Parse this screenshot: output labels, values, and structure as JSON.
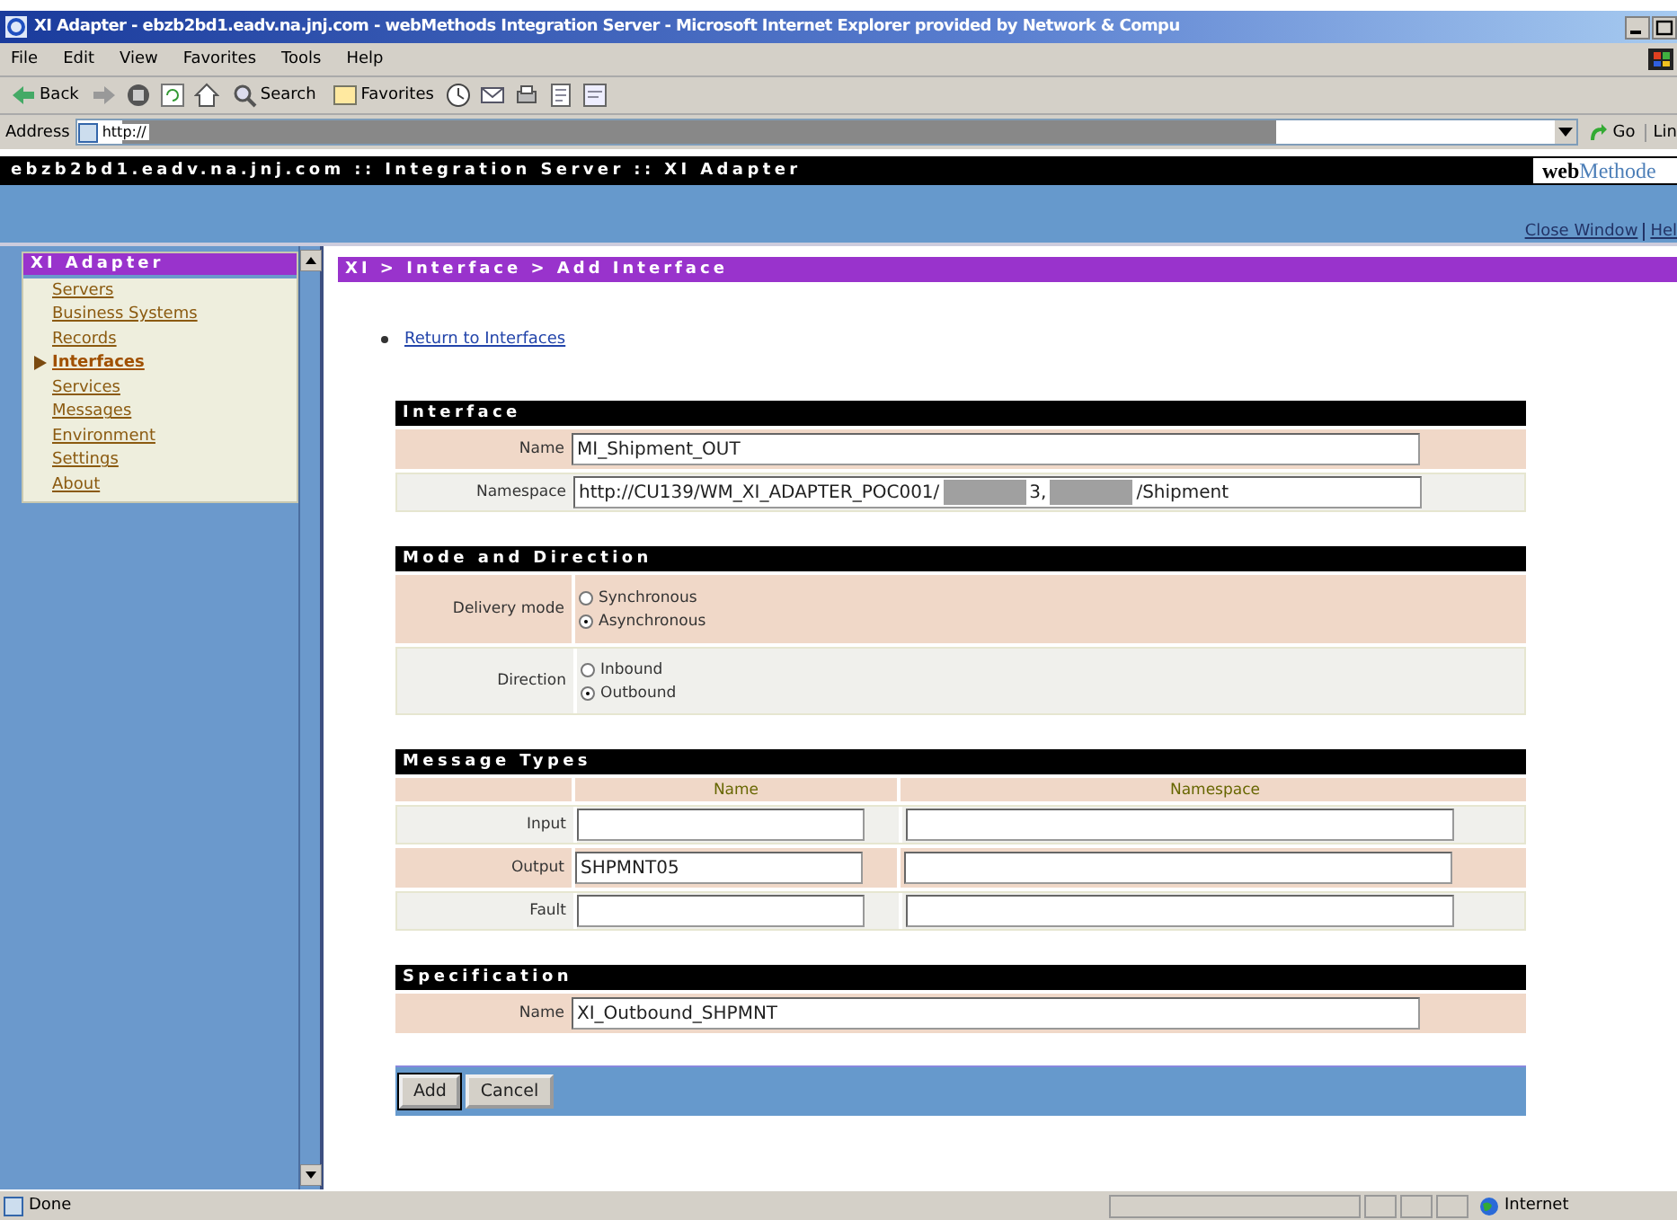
{
  "window": {
    "title": "XI Adapter - ebzb2bd1.eadv.na.jnj.com - webMethods Integration Server - Microsoft Internet Explorer provided by Network & Compu"
  },
  "menu": [
    "File",
    "Edit",
    "View",
    "Favorites",
    "Tools",
    "Help"
  ],
  "toolbar": [
    {
      "kind": "back",
      "label": "Back"
    },
    {
      "kind": "forward"
    },
    {
      "kind": "stop"
    },
    {
      "kind": "refresh"
    },
    {
      "kind": "home"
    },
    {
      "kind": "search",
      "label": "Search"
    },
    {
      "kind": "favorites",
      "label": "Favorites"
    },
    {
      "kind": "history"
    },
    {
      "kind": "mail"
    },
    {
      "kind": "print"
    },
    {
      "kind": "edit"
    },
    {
      "kind": "discuss"
    }
  ],
  "address": {
    "label": "Address",
    "value": "http://",
    "go": "Go",
    "links": "Lin"
  },
  "banner": {
    "title": "ebzb2bd1.eadv.na.jnj.com :: Integration Server :: XI Adapter",
    "logo_dark": "web",
    "logo_light": "Methode"
  },
  "top_links": [
    "Close Window",
    "Hel"
  ],
  "nav": {
    "title": "XI Adapter",
    "items": [
      {
        "label": "Servers",
        "selected": false
      },
      {
        "label": "Business Systems",
        "selected": false
      },
      {
        "label": "Records",
        "selected": false
      },
      {
        "label": "Interfaces",
        "selected": true
      },
      {
        "label": "Services",
        "selected": false
      },
      {
        "label": "Messages",
        "selected": false
      },
      {
        "label": "Environment",
        "selected": false
      },
      {
        "label": "Settings",
        "selected": false
      },
      {
        "label": "About",
        "selected": false
      }
    ]
  },
  "breadcrumb": "XI > Interface > Add Interface",
  "return_link": "Return to Interfaces",
  "sections": [
    {
      "title": "Interface",
      "kind": "fields",
      "rows": [
        {
          "label": "Name",
          "value_parts": [
            {
              "kind": "text",
              "text": "MI_Shipment_OUT"
            }
          ]
        },
        {
          "label": "Namespace",
          "value_parts": [
            {
              "kind": "text",
              "text": "http://CU139/WM_XI_ADAPTER_POC001/"
            },
            {
              "kind": "redacted"
            },
            {
              "kind": "text",
              "text": "3,"
            },
            {
              "kind": "redacted"
            },
            {
              "kind": "text",
              "text": "/Shipment"
            }
          ]
        }
      ]
    },
    {
      "title": "Mode and Direction",
      "kind": "radios",
      "rows": [
        {
          "label": "Delivery mode",
          "options": [
            {
              "label": "Synchronous",
              "selected": false
            },
            {
              "label": "Asynchronous",
              "selected": true
            }
          ]
        },
        {
          "label": "Direction",
          "options": [
            {
              "label": "Inbound",
              "selected": false
            },
            {
              "label": "Outbound",
              "selected": true
            }
          ]
        }
      ]
    },
    {
      "title": "Message Types",
      "kind": "grid",
      "columns": [
        "Name",
        "Namespace"
      ],
      "rows": [
        {
          "label": "Input"
        },
        {
          "label": "Output",
          "name": "SHPMNT05"
        },
        {
          "label": "Fault"
        }
      ]
    },
    {
      "title": "Specification",
      "kind": "fields",
      "rows": [
        {
          "label": "Name",
          "value_parts": [
            {
              "kind": "text",
              "text": "XI_Outbound_SHPMNT"
            }
          ]
        }
      ]
    }
  ],
  "buttons": [
    "Add",
    "Cancel"
  ],
  "status": {
    "text": "Done",
    "zone": "Internet"
  }
}
